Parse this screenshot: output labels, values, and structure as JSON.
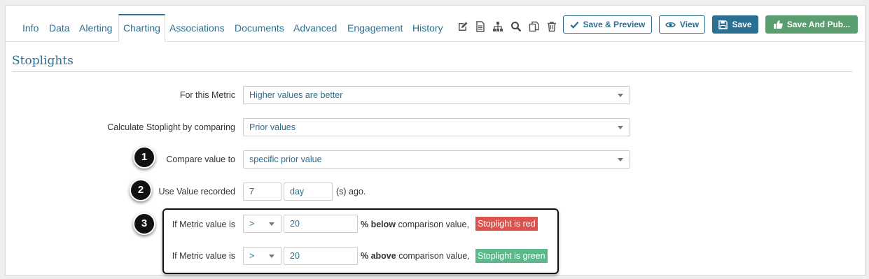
{
  "tabs": [
    {
      "label": "Info"
    },
    {
      "label": "Data"
    },
    {
      "label": "Alerting"
    },
    {
      "label": "Charting",
      "active": true
    },
    {
      "label": "Associations"
    },
    {
      "label": "Documents"
    },
    {
      "label": "Advanced"
    },
    {
      "label": "Engagement"
    },
    {
      "label": "History"
    }
  ],
  "toolbar": {
    "icons": [
      "edit-icon",
      "document-icon",
      "hierarchy-icon",
      "search-icon",
      "copy-icon",
      "trash-icon"
    ],
    "save_preview_label": "Save & Preview",
    "view_label": "View",
    "save_label": "Save",
    "save_publish_label": "Save And Pub..."
  },
  "section": {
    "title": "Stoplights"
  },
  "form": {
    "metric_label": "For this Metric",
    "metric_value": "Higher values are better",
    "calc_label": "Calculate Stoplight by comparing",
    "calc_value": "Prior values",
    "compare_label": "Compare value to",
    "compare_value": "specific prior value",
    "use_label": "Use Value recorded",
    "use_number": "7",
    "use_unit": "day",
    "use_suffix": "(s) ago.",
    "rule_label": "If Metric value is",
    "red_rule": {
      "operator": ">",
      "value": "20",
      "bold_text": "% below",
      "text": " comparison value,",
      "stoplight": "Stoplight is red"
    },
    "green_rule": {
      "operator": ">",
      "value": "20",
      "bold_text": "% above",
      "text": " comparison value,",
      "stoplight": "Stoplight is green"
    }
  },
  "callouts": [
    "1",
    "2",
    "3"
  ],
  "colors": {
    "accent": "#2b6f92",
    "publish": "#5a9e6f",
    "red": "#d9534f",
    "green": "#5cb88a"
  }
}
